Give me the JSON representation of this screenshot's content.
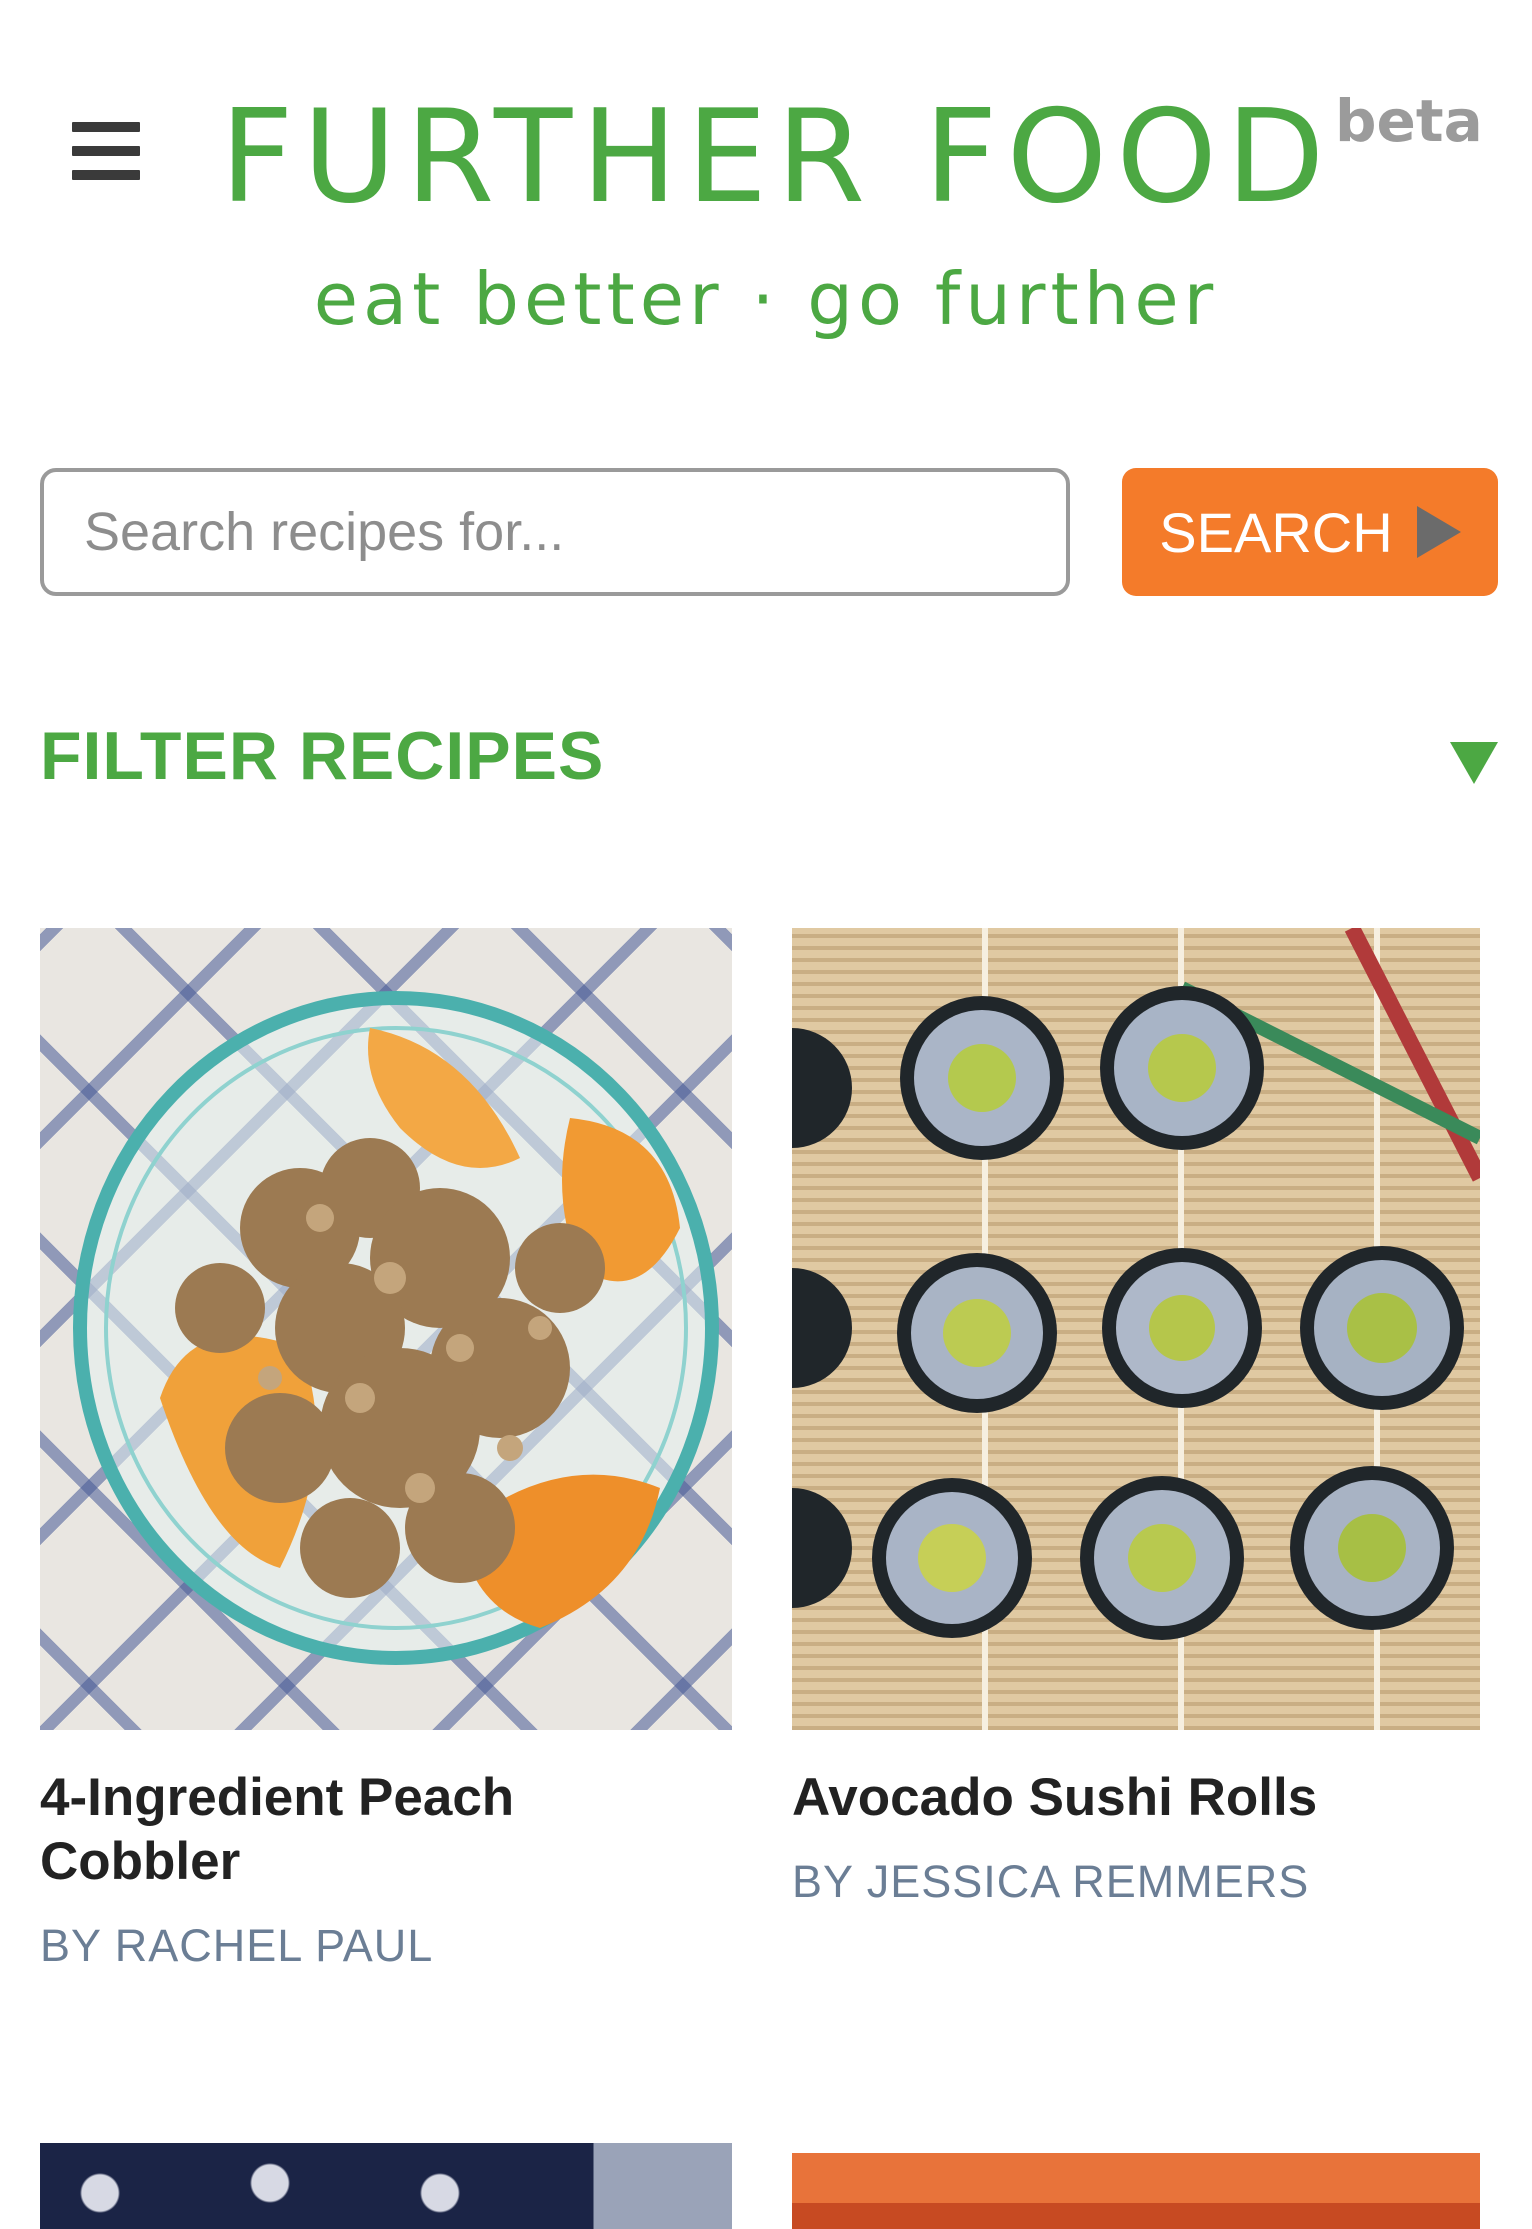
{
  "header": {
    "menu_icon": "hamburger-menu-icon",
    "brand_name": "FURTHER FOOD",
    "brand_badge": "beta",
    "tagline": "eat better · go further"
  },
  "search": {
    "placeholder": "Search recipes for...",
    "value": "",
    "button_label": "SEARCH",
    "button_icon": "play-triangle-icon"
  },
  "filter": {
    "title": "FILTER RECIPES",
    "toggle_icon": "triangle-down-icon"
  },
  "recipes": [
    {
      "title_line1": "4-Ingredient Peach",
      "title_line2": "Cobbler",
      "author": "BY RACHEL PAUL"
    },
    {
      "title_line1": "Avocado Sushi Rolls",
      "title_line2": "",
      "author": "BY JESSICA REMMERS"
    }
  ],
  "colors": {
    "brand_green": "#4ca843",
    "search_orange": "#f47b2a",
    "author_gray_blue": "#6b7e95",
    "title_dark": "#222222"
  }
}
